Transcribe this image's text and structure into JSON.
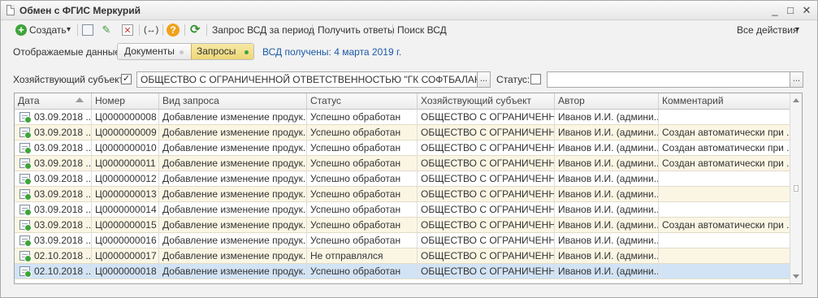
{
  "window": {
    "title": "Обмен с ФГИС Меркурий",
    "min_glyph": "_",
    "max_glyph": "□",
    "close_glyph": "✕"
  },
  "toolbar": {
    "create_label": "Создать",
    "dropdown_glyph": "▾",
    "period_request_label": "Запрос ВСД за период",
    "get_answers_label": "Получить ответы",
    "search_vsd_label": "Поиск ВСД",
    "all_actions_label": "Все действия",
    "icons": [
      "add-icon",
      "copy-icon",
      "edit-icon",
      "delete-icon",
      "exchange-icon",
      "help-icon",
      "refresh-icon"
    ],
    "exchange_glyph": "(↔)",
    "help_glyph": "?",
    "refresh_glyph": "⟳",
    "delete_glyph": "✕",
    "edit_glyph": "✎",
    "add_glyph": "+"
  },
  "filter": {
    "label": "Отображаемые данные:",
    "options": [
      "Документы",
      "Запросы"
    ],
    "selected": "Запросы",
    "vsd_received": "ВСД получены: 4 марта 2019 г."
  },
  "subject": {
    "label": "Хозяйствующий субъект:",
    "checked": true,
    "check_glyph": "✓",
    "value": "ОБЩЕСТВО С ОГРАНИЧЕННОЙ ОТВЕТСТВЕННОСТЬЮ \"ГК СОФТБАЛАНС\"",
    "choose_glyph": "...",
    "status_label": "Статус:",
    "status_checked": false,
    "status_value": ""
  },
  "table": {
    "columns": [
      "Дата",
      "Номер",
      "Вид запроса",
      "Статус",
      "Хозяйствующий субъект",
      "Автор",
      "Комментарий"
    ],
    "rows": [
      [
        "03.09.2018 ...",
        "Ц0000000008",
        "Добавление изменение продук...",
        "Успешно обработан",
        "ОБЩЕСТВО С ОГРАНИЧЕНН...",
        "Иванов И.И. (админи...",
        ""
      ],
      [
        "03.09.2018 ...",
        "Ц0000000009",
        "Добавление изменение продук...",
        "Успешно обработан",
        "ОБЩЕСТВО С ОГРАНИЧЕНН...",
        "Иванов И.И. (админи...",
        "Создан автоматически при ..."
      ],
      [
        "03.09.2018 ...",
        "Ц0000000010",
        "Добавление изменение продук...",
        "Успешно обработан",
        "ОБЩЕСТВО С ОГРАНИЧЕНН...",
        "Иванов И.И. (админи...",
        "Создан автоматически при ..."
      ],
      [
        "03.09.2018 ...",
        "Ц0000000011",
        "Добавление изменение продук...",
        "Успешно обработан",
        "ОБЩЕСТВО С ОГРАНИЧЕНН...",
        "Иванов И.И. (админи...",
        "Создан автоматически при ..."
      ],
      [
        "03.09.2018 ...",
        "Ц0000000012",
        "Добавление изменение продук...",
        "Успешно обработан",
        "ОБЩЕСТВО С ОГРАНИЧЕНН...",
        "Иванов И.И. (админи...",
        ""
      ],
      [
        "03.09.2018 ...",
        "Ц0000000013",
        "Добавление изменение продук...",
        "Успешно обработан",
        "ОБЩЕСТВО С ОГРАНИЧЕНН...",
        "Иванов И.И. (админи...",
        ""
      ],
      [
        "03.09.2018 ...",
        "Ц0000000014",
        "Добавление изменение продук...",
        "Успешно обработан",
        "ОБЩЕСТВО С ОГРАНИЧЕНН...",
        "Иванов И.И. (админи...",
        ""
      ],
      [
        "03.09.2018 ...",
        "Ц0000000015",
        "Добавление изменение продук...",
        "Успешно обработан",
        "ОБЩЕСТВО С ОГРАНИЧЕНН...",
        "Иванов И.И. (админи...",
        "Создан автоматически при ..."
      ],
      [
        "03.09.2018 ...",
        "Ц0000000016",
        "Добавление изменение продук...",
        "Успешно обработан",
        "ОБЩЕСТВО С ОГРАНИЧЕНН...",
        "Иванов И.И. (админи...",
        ""
      ],
      [
        "02.10.2018 ...",
        "Ц0000000017",
        "Добавление изменение продук...",
        "Не отправлялся",
        "ОБЩЕСТВО С ОГРАНИЧЕНН...",
        "Иванов И.И. (админи...",
        ""
      ],
      [
        "02.10.2018 ...",
        "Ц0000000018",
        "Добавление изменение продук...",
        "Успешно обработан",
        "ОБЩЕСТВО С ОГРАНИЧЕНН...",
        "Иванов И.И. (админи...",
        ""
      ]
    ],
    "selected_row": 10,
    "row_icon": "document-green-icon"
  },
  "colors": {
    "accent_green": "#3fa33a",
    "link_blue": "#1c5aa8",
    "selected_row": "#d2e3f5",
    "segment_active": "#eed777",
    "help_orange": "#f0a21b",
    "delete_red": "#d23b2f"
  }
}
